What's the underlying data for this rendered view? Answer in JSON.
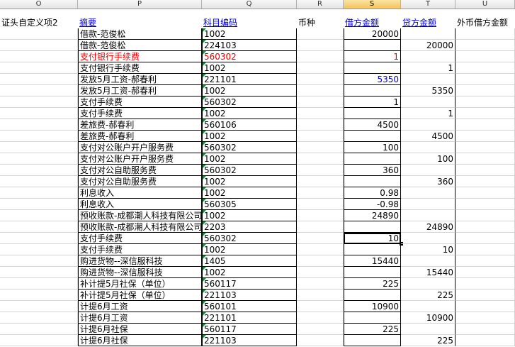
{
  "columns": [
    "O",
    "P",
    "Q",
    "R",
    "S",
    "T",
    "U"
  ],
  "selected_column": "S",
  "header": {
    "o": "证头自定义项2",
    "p": "摘要",
    "q": "科目编码",
    "r": "币种",
    "s": "借方金额",
    "t": "贷方金额",
    "u": "外币借方金额"
  },
  "rows": [
    {
      "summary": "借款-范俊松",
      "code": "1002",
      "debit": "20000",
      "credit": ""
    },
    {
      "summary": "借款-范俊松",
      "code": "224103",
      "debit": "",
      "credit": "20000"
    },
    {
      "summary": "支付银行手续费",
      "code": "560302",
      "debit": "1",
      "credit": "",
      "red": true
    },
    {
      "summary": "支付银行手续费",
      "code": "1002",
      "debit": "",
      "credit": "1"
    },
    {
      "summary": "发放5月工资-郝春利",
      "code": "221101",
      "debit": "5350",
      "credit": ""
    },
    {
      "summary": "发放5月工资-郝春利",
      "code": "1002",
      "debit": "",
      "credit": "5350"
    },
    {
      "summary": "支付手续费",
      "code": "560302",
      "debit": "1",
      "credit": ""
    },
    {
      "summary": "支付手续费",
      "code": "1002",
      "debit": "",
      "credit": "1"
    },
    {
      "summary": "差旅费-郝春利",
      "code": "560106",
      "debit": "4500",
      "credit": ""
    },
    {
      "summary": "差旅费-郝春利",
      "code": "1002",
      "debit": "",
      "credit": "4500"
    },
    {
      "summary": "支付对公账户开户服务费",
      "code": "560302",
      "debit": "100",
      "credit": ""
    },
    {
      "summary": "支付对公账户开户服务费",
      "code": "1002",
      "debit": "",
      "credit": "100"
    },
    {
      "summary": "支付对公自助服务费",
      "code": "560302",
      "debit": "360",
      "credit": ""
    },
    {
      "summary": "支付对公自助服务费",
      "code": "1002",
      "debit": "",
      "credit": "360"
    },
    {
      "summary": "利息收入",
      "code": "1002",
      "debit": "0.98",
      "credit": ""
    },
    {
      "summary": "利息收入",
      "code": "560305",
      "debit": "-0.98",
      "credit": ""
    },
    {
      "summary": "预收账款-成都潮人科技有限公司",
      "code": "1002",
      "debit": "24890",
      "credit": ""
    },
    {
      "summary": "预收账款-成都潮人科技有限公司",
      "code": "2203",
      "debit": "",
      "credit": "24890"
    },
    {
      "summary": "支付手续费",
      "code": "560302",
      "debit": "10",
      "credit": "",
      "active": true
    },
    {
      "summary": "支付手续费",
      "code": "1002",
      "debit": "",
      "credit": "10"
    },
    {
      "summary": "购进货物--深信服科技",
      "code": "1405",
      "debit": "15440",
      "credit": ""
    },
    {
      "summary": "购进货物--深信服科技",
      "code": "1002",
      "debit": "",
      "credit": "15440"
    },
    {
      "summary": "补计提5月社保（单位）",
      "code": "560117",
      "debit": "225",
      "credit": ""
    },
    {
      "summary": "补计提5月社保（单位）",
      "code": "221103",
      "debit": "",
      "credit": "225"
    },
    {
      "summary": "计提6月工资",
      "code": "560101",
      "debit": "10900",
      "credit": ""
    },
    {
      "summary": "计提6月工资",
      "code": "221101",
      "debit": "",
      "credit": "10900"
    },
    {
      "summary": "计提6月社保",
      "code": "560117",
      "debit": "225",
      "credit": ""
    },
    {
      "summary": "计提6月社保",
      "code": "221103",
      "debit": "",
      "credit": "225"
    }
  ],
  "colors": {
    "link_blue": "#0000c8",
    "red": "#e00000",
    "marker_green": "#1a8a3a"
  }
}
